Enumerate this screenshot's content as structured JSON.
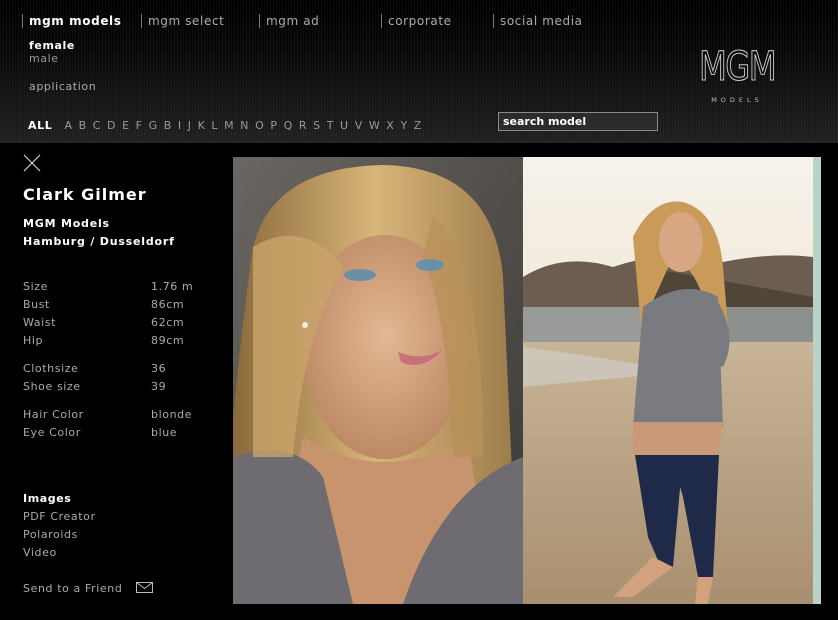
{
  "nav": {
    "items": [
      "mgm models",
      "mgm select",
      "mgm ad",
      "corporate",
      "social media"
    ],
    "active_index": 0
  },
  "subnav": {
    "female": "female",
    "male": "male",
    "application": "application"
  },
  "logo": {
    "brand": "MGM",
    "tagline": "MODELS"
  },
  "alphabet": {
    "all": "ALL",
    "letters": [
      "A",
      "B",
      "C",
      "D",
      "E",
      "F",
      "G",
      "B",
      "I",
      "J",
      "K",
      "L",
      "M",
      "N",
      "O",
      "P",
      "Q",
      "R",
      "S",
      "T",
      "U",
      "V",
      "W",
      "X",
      "Y",
      "Z"
    ]
  },
  "search": {
    "placeholder": "search model"
  },
  "model": {
    "name": "Clark Gilmer",
    "agency_line1": "MGM Models",
    "agency_line2": "Hamburg / Dusseldorf"
  },
  "stats": [
    {
      "label": "Size",
      "value": "1.76 m"
    },
    {
      "label": "Bust",
      "value": "86cm"
    },
    {
      "label": "Waist",
      "value": "62cm"
    },
    {
      "label": "Hip",
      "value": "89cm"
    },
    {
      "label": "Clothsize",
      "value": "36"
    },
    {
      "label": "Shoe size",
      "value": "39"
    },
    {
      "label": "Hair Color",
      "value": "blonde"
    },
    {
      "label": "Eye Color",
      "value": "blue"
    }
  ],
  "images_section": {
    "title": "Images",
    "links": [
      "PDF Creator",
      "Polaroids",
      "Video"
    ]
  },
  "send_to_friend": "Send to a Friend",
  "icons": {
    "close": "close-icon",
    "mail": "envelope-icon"
  },
  "colors": {
    "background": "#000000",
    "text_muted": "#aaaaaa",
    "text_bright": "#ffffff",
    "search_bg": "#2b2b2b",
    "scroll_strip": "#b9d3c6"
  }
}
